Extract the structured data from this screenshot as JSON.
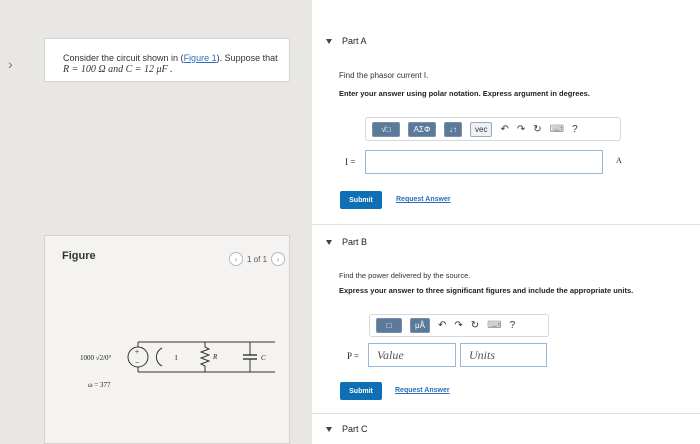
{
  "left": {
    "arrow": "›",
    "problem": {
      "intro": "Consider the circuit shown in (",
      "figure_link": "Figure 1",
      "after_link": "). Suppose that",
      "line2": "R = 100 Ω and C = 12 μF ."
    },
    "figure": {
      "label": "Figure",
      "pager_text": "1 of 1",
      "prev": "‹",
      "next": "›"
    },
    "circuit": {
      "source_text": "1000 √2/0°",
      "omega_text": "ω = 377",
      "current_label": "I",
      "resistor_label": "R",
      "capacitor_label": "C"
    }
  },
  "partA": {
    "title": "Part A",
    "question": "Find the phasor current I.",
    "instruction": "Enter your answer using polar notation. Express argument in degrees.",
    "toolbar": {
      "templates": "√□",
      "greek": "ΑΣΦ",
      "updown": "↓↑",
      "vec": "vec",
      "undo": "↶",
      "redo": "↷",
      "reset": "↻",
      "keyboard": "⌨",
      "help": "?"
    },
    "input_label": "I =",
    "unit": "A",
    "submit": "Submit",
    "request": "Request Answer"
  },
  "partB": {
    "title": "Part B",
    "question": "Find the power delivered by the source.",
    "instruction": "Express your answer to three significant figures and include the appropriate units.",
    "toolbar": {
      "templates": "□",
      "units": "μÅ",
      "undo": "↶",
      "redo": "↷",
      "reset": "↻",
      "keyboard": "⌨",
      "help": "?"
    },
    "input_label": "P =",
    "value_placeholder": "Value",
    "units_placeholder": "Units",
    "submit": "Submit",
    "request": "Request Answer"
  },
  "partC": {
    "title": "Part C"
  }
}
